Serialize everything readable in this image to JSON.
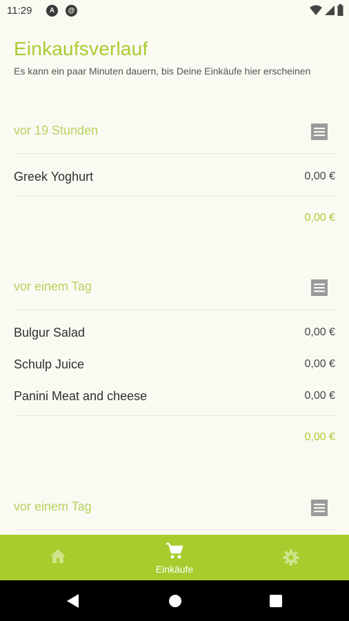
{
  "status_bar": {
    "time": "11:29"
  },
  "header": {
    "title": "Einkaufsverlauf",
    "subtitle": "Es kann ein paar Minuten dauern, bis Deine Einkäufe hier erscheinen"
  },
  "groups": [
    {
      "label": "vor 19 Stunden",
      "items": [
        {
          "name": "Greek Yoghurt",
          "price": "0,00 €"
        }
      ],
      "total": "0,00 €"
    },
    {
      "label": "vor einem Tag",
      "items": [
        {
          "name": "Bulgur Salad",
          "price": "0,00 €"
        },
        {
          "name": "Schulp Juice",
          "price": "0,00 €"
        },
        {
          "name": "Panini Meat and cheese",
          "price": "0,00 €"
        }
      ],
      "total": "0,00 €"
    },
    {
      "label": "vor einem Tag",
      "items": [],
      "total": ""
    }
  ],
  "bottom_nav": {
    "items": [
      {
        "icon": "home-icon",
        "label": ""
      },
      {
        "icon": "cart-icon",
        "label": "Einkäufe",
        "active": true
      },
      {
        "icon": "gear-icon",
        "label": ""
      }
    ]
  },
  "colors": {
    "accent": "#a8cc2e",
    "background": "#fafaf3"
  }
}
